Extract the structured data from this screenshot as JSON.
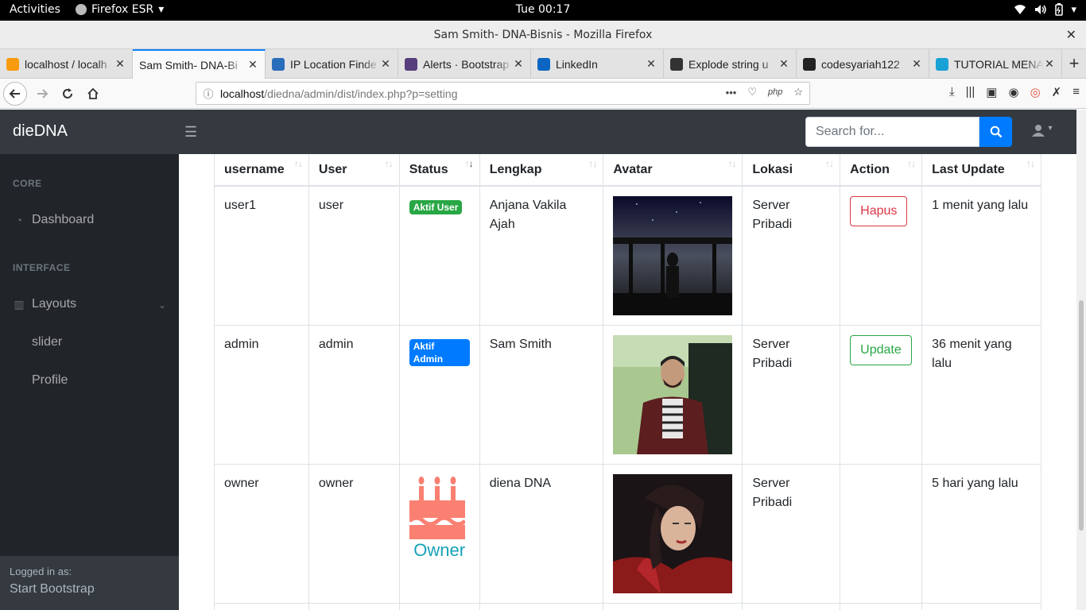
{
  "gnome": {
    "activities": "Activities",
    "app": "Firefox ESR",
    "clock": "Tue 00:17"
  },
  "window": {
    "title": "Sam Smith- DNA-Bisnis - Mozilla Firefox"
  },
  "tabs": [
    {
      "label": "localhost / localh",
      "icon": "phpmyadmin-icon",
      "color": "#f89c0e"
    },
    {
      "label": "Sam Smith- DNA-Bi",
      "icon": "none",
      "color": "",
      "active": true
    },
    {
      "label": "IP Location Finde",
      "icon": "ip-location-icon",
      "color": "#2a6ebb"
    },
    {
      "label": "Alerts · Bootstrap",
      "icon": "bootstrap-icon",
      "color": "#563d7c"
    },
    {
      "label": "LinkedIn",
      "icon": "linkedin-icon",
      "color": "#0a66c2"
    },
    {
      "label": "Explode string u",
      "icon": "stackoverflow-icon",
      "color": "#333"
    },
    {
      "label": "codesyariah122",
      "icon": "github-icon",
      "color": "#222"
    },
    {
      "label": "TUTORIAL MENA",
      "icon": "tutorial-icon",
      "color": "#1aa1d6"
    }
  ],
  "url": {
    "host": "localhost",
    "path": "/diedna/admin/dist/index.php?p=setting",
    "php_badge": "php"
  },
  "topnav": {
    "brand": "dieDNA",
    "search_placeholder": "Search for..."
  },
  "sidenav": {
    "heading_core": "CORE",
    "dashboard": "Dashboard",
    "heading_interface": "INTERFACE",
    "layouts": "Layouts",
    "slider": "slider",
    "profile": "Profile",
    "footer_small": "Logged in as:",
    "footer_name": "Start Bootstrap"
  },
  "table": {
    "headers": [
      "username",
      "User",
      "Status",
      "Lengkap",
      "Avatar",
      "Lokasi",
      "Action",
      "Last Update"
    ],
    "rows": [
      {
        "username": "user1",
        "user": "user",
        "status": "Aktif User",
        "status_color": "#28a745",
        "lengkap": "Anjana Vakila Ajah",
        "lokasi": "Server Pribadi",
        "action": "Hapus",
        "last_update": "1 menit yang lalu"
      },
      {
        "username": "admin",
        "user": "admin",
        "status": "Aktif Admin",
        "status_color": "#007bff",
        "lengkap": "Sam Smith",
        "lokasi": "Server Pribadi",
        "action": "Update",
        "last_update": "36 menit yang lalu"
      },
      {
        "username": "owner",
        "user": "owner",
        "status": "Owner",
        "status_icon": "birthday-cake-icon",
        "status_color": "#fa8072",
        "lengkap": "diena DNA",
        "lokasi": "Server Pribadi",
        "action": "",
        "last_update": "5 hari yang lalu"
      }
    ]
  }
}
